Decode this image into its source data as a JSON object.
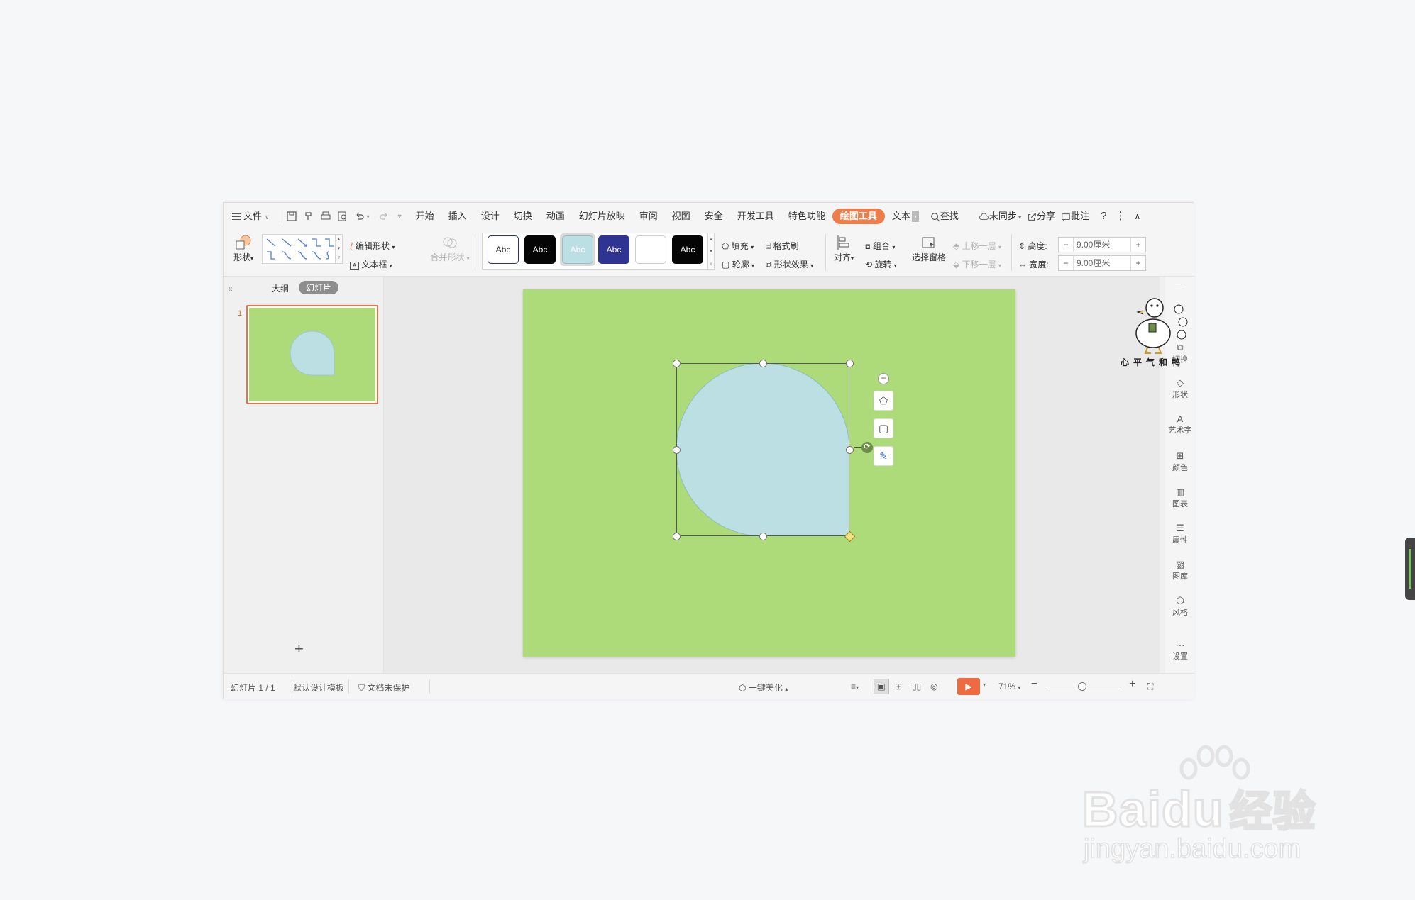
{
  "menubar": {
    "file": "文件",
    "tabs": [
      "开始",
      "插入",
      "设计",
      "切换",
      "动画",
      "幻灯片放映",
      "审阅",
      "视图",
      "安全",
      "开发工具",
      "特色功能",
      "绘图工具",
      "文本"
    ],
    "active_tab": "绘图工具",
    "search": "查找",
    "sync": "未同步",
    "share": "分享",
    "comment": "批注"
  },
  "toolbar": {
    "shape": "形状",
    "edit_shape": "编辑形状",
    "text_box": "文本框",
    "merge_shape": "合并形状",
    "style_label": "Abc",
    "fill": "填充",
    "format_brush": "格式刷",
    "outline": "轮廓",
    "shape_effect": "形状效果",
    "align": "对齐",
    "group": "组合",
    "rotate": "旋转",
    "selection_pane": "选择窗格",
    "move_up": "上移一层",
    "move_down": "下移一层",
    "height_label": "高度:",
    "height_value": "9.00厘米",
    "width_label": "宽度:",
    "width_value": "9.00厘米"
  },
  "left_panel": {
    "outline_tab": "大纲",
    "slides_tab": "幻灯片",
    "slide_number": "1"
  },
  "right_panel": {
    "items": [
      "切换",
      "形状",
      "艺术字",
      "颜色",
      "图表",
      "属性",
      "图库",
      "风格",
      "设置"
    ]
  },
  "sticker": {
    "caption": "心平气和鸭"
  },
  "statusbar": {
    "slide_count": "幻灯片 1 / 1",
    "template": "默认设计模板",
    "protection": "文档未保护",
    "beautify": "一键美化",
    "zoom": "71%"
  },
  "watermark": {
    "brand": "Bai",
    "brand2": "du",
    "cn": "经验",
    "url": "jingyan.baidu.com"
  },
  "colors": {
    "accent": "#ee7d4c",
    "slide_bg": "#addb7a",
    "shape_fill": "#bbdfe3",
    "adjust_handle": "#f5e37a"
  }
}
